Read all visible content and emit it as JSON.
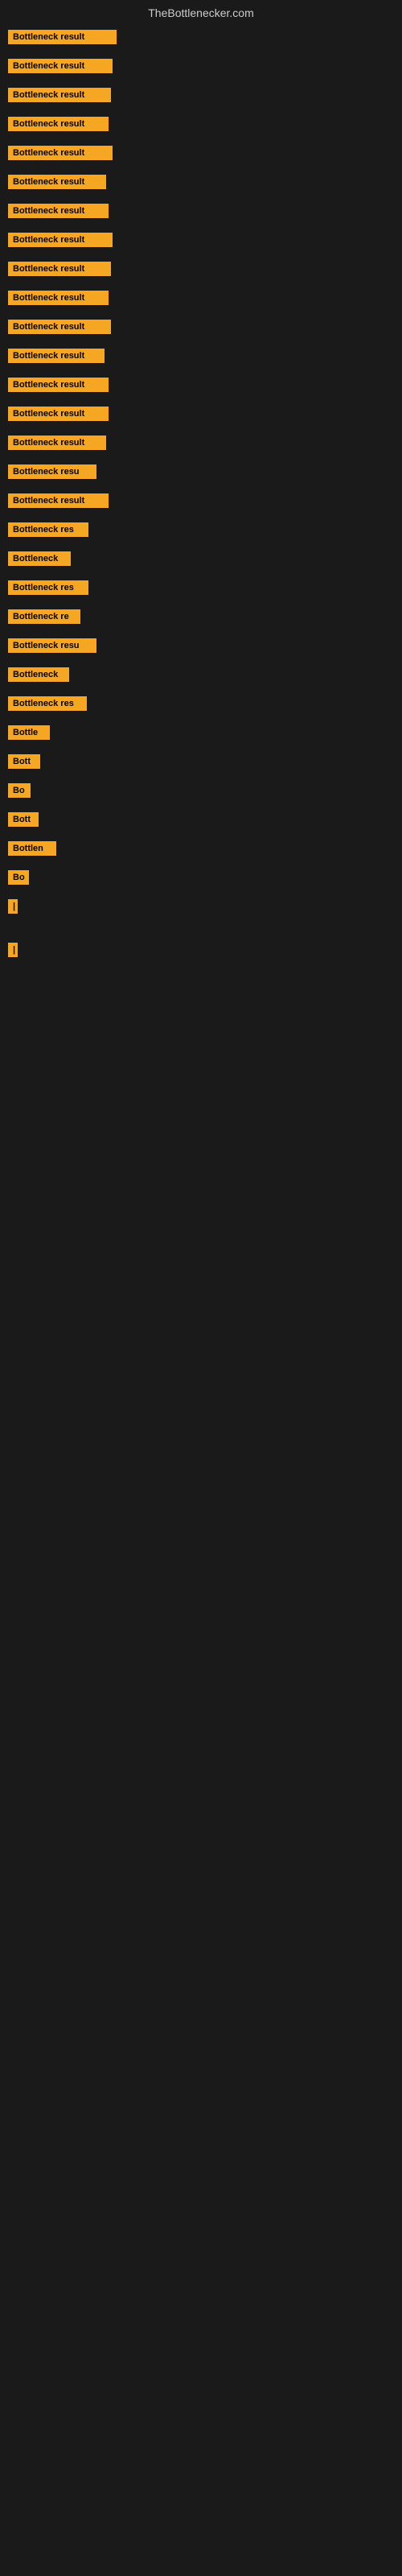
{
  "header": {
    "title": "TheBottlenecker.com"
  },
  "items": [
    {
      "label": "Bottleneck result",
      "width": 135
    },
    {
      "label": "Bottleneck result",
      "width": 130
    },
    {
      "label": "Bottleneck result",
      "width": 128
    },
    {
      "label": "Bottleneck result",
      "width": 125
    },
    {
      "label": "Bottleneck result",
      "width": 130
    },
    {
      "label": "Bottleneck result",
      "width": 122
    },
    {
      "label": "Bottleneck result",
      "width": 125
    },
    {
      "label": "Bottleneck result",
      "width": 130
    },
    {
      "label": "Bottleneck result",
      "width": 128
    },
    {
      "label": "Bottleneck result",
      "width": 125
    },
    {
      "label": "Bottleneck result",
      "width": 128
    },
    {
      "label": "Bottleneck result",
      "width": 120
    },
    {
      "label": "Bottleneck result",
      "width": 125
    },
    {
      "label": "Bottleneck result",
      "width": 125
    },
    {
      "label": "Bottleneck result",
      "width": 122
    },
    {
      "label": "Bottleneck resu",
      "width": 110
    },
    {
      "label": "Bottleneck result",
      "width": 125
    },
    {
      "label": "Bottleneck res",
      "width": 100
    },
    {
      "label": "Bottleneck",
      "width": 78
    },
    {
      "label": "Bottleneck res",
      "width": 100
    },
    {
      "label": "Bottleneck re",
      "width": 90
    },
    {
      "label": "Bottleneck resu",
      "width": 110
    },
    {
      "label": "Bottleneck",
      "width": 76
    },
    {
      "label": "Bottleneck res",
      "width": 98
    },
    {
      "label": "Bottle",
      "width": 52
    },
    {
      "label": "Bott",
      "width": 40
    },
    {
      "label": "Bo",
      "width": 28
    },
    {
      "label": "Bott",
      "width": 38
    },
    {
      "label": "Bottlen",
      "width": 60
    },
    {
      "label": "Bo",
      "width": 26
    },
    {
      "label": "|",
      "width": 8
    },
    {
      "label": "",
      "width": 6
    },
    {
      "label": "|",
      "width": 8
    },
    {
      "label": "",
      "width": 4
    },
    {
      "label": "",
      "width": 4
    },
    {
      "label": "",
      "width": 4
    }
  ]
}
